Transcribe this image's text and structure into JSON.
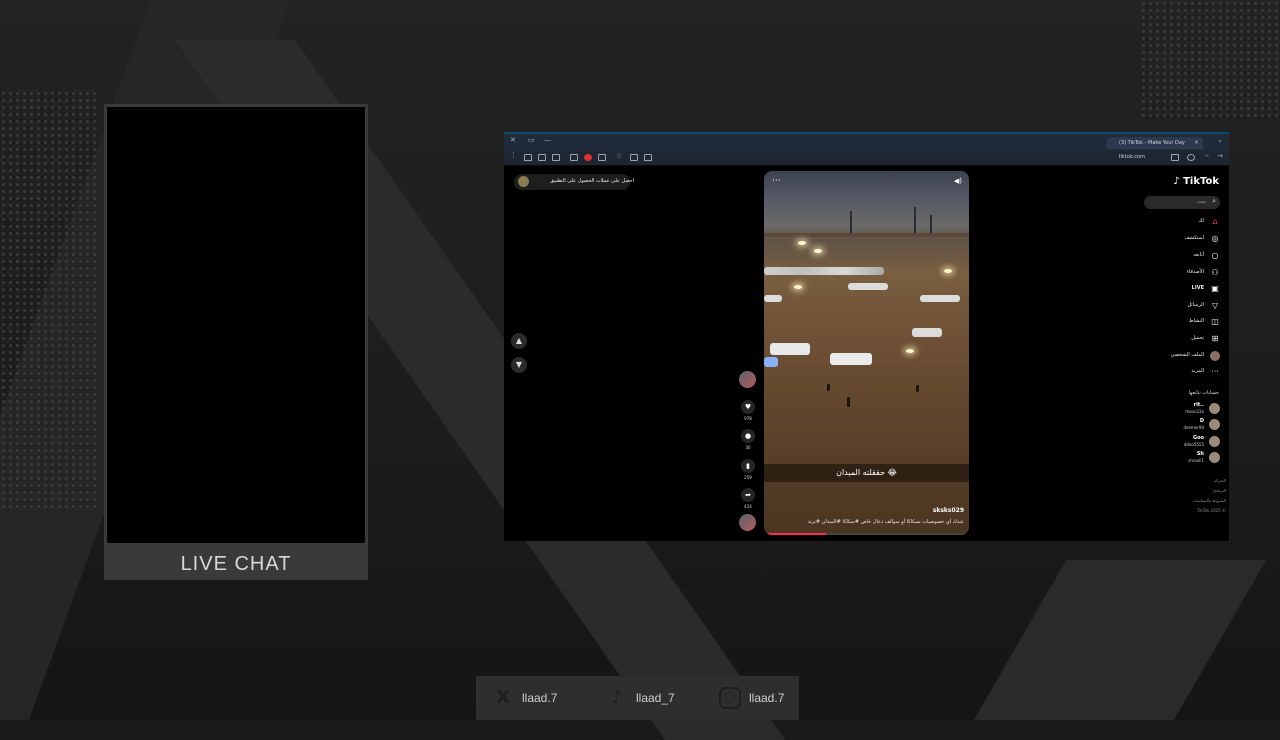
{
  "chat": {
    "label": "LIVE CHAT"
  },
  "browser": {
    "tab_title": "(3) TikTok - Make Your Day",
    "url": "tiktok.com"
  },
  "tiktok": {
    "top_pill": {
      "get_coins": "احصل على عملات",
      "get_app": "الحصول على التطبيق"
    },
    "logo": "TikTok",
    "search_placeholder": "بحث",
    "nav": [
      {
        "label": "لك",
        "icon": "home-icon"
      },
      {
        "label": "استكشف",
        "icon": "compass-icon"
      },
      {
        "label": "أتابعه",
        "icon": "following-icon"
      },
      {
        "label": "الأصدقاء",
        "icon": "friends-icon"
      },
      {
        "label": "LIVE",
        "icon": "live-icon"
      },
      {
        "label": "الرسائل",
        "icon": "messages-icon"
      },
      {
        "label": "النشاط",
        "icon": "activity-icon"
      },
      {
        "label": "تحميل",
        "icon": "upload-icon"
      },
      {
        "label": "الملف الشخصي",
        "icon": "profile-icon"
      },
      {
        "label": "المزيد",
        "icon": "more-icon"
      }
    ],
    "following_header": "حسابات تتابعها",
    "accounts": [
      {
        "name": "rit..",
        "sub": "moon22x"
      },
      {
        "name": "D",
        "sub": "deemer90"
      },
      {
        "name": "Goo",
        "sub": "ddoo5555"
      },
      {
        "name": "Sh",
        "sub": "shrooll1"
      }
    ],
    "footer": [
      "الشركة",
      "البرنامج",
      "الشروط والسياسات",
      "TikTok 2025 ©"
    ],
    "video": {
      "caption_overlay": "حققلته الميدان 😂",
      "username": "sksks029",
      "description": "عندك أي خصوصيات بسكاكا أو سوالف دعال خاص #سكاكا #الميدان #ترند",
      "progress": 0.3
    },
    "actions": {
      "likes": "978",
      "comments": "30",
      "saves": "259",
      "shares": "424"
    }
  },
  "social": [
    {
      "icon": "x-icon",
      "handle": "llaad.7"
    },
    {
      "icon": "tiktok-icon",
      "handle": "llaad_7"
    },
    {
      "icon": "instagram-icon",
      "handle": "llaad.7"
    }
  ]
}
